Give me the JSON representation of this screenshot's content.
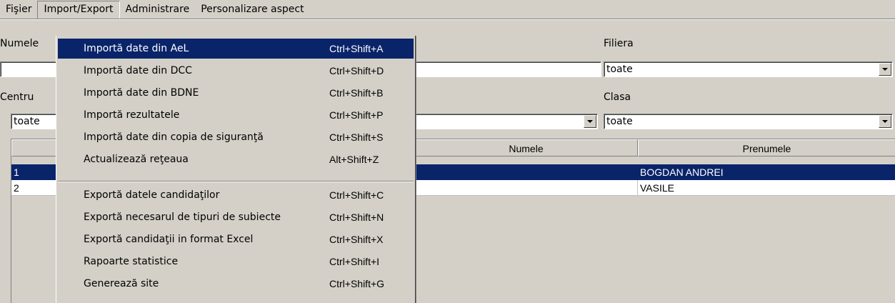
{
  "menubar": [
    "Fişier",
    "Import/Export",
    "Administrare",
    "Personalizare aspect"
  ],
  "filters": {
    "numele_label": "Numele",
    "filiera_label": "Filiera",
    "filiera_value": "toate",
    "centru_label": "Centru",
    "centru_value": "toate",
    "clasa_label": "Clasa",
    "clasa_value": "toate"
  },
  "grid": {
    "headers": {
      "numele": "Numele",
      "prenumele": "Prenumele"
    },
    "rows": [
      {
        "nr": "1",
        "prenumele": "BOGDAN ANDREI"
      },
      {
        "nr": "2",
        "prenumele": "VASILE"
      }
    ]
  },
  "menu": [
    {
      "label": "Importă date din AeL",
      "shortcut": "Ctrl+Shift+A"
    },
    {
      "label": "Importă date din DCC",
      "shortcut": "Ctrl+Shift+D"
    },
    {
      "label": "Importă date din BDNE",
      "shortcut": "Ctrl+Shift+B"
    },
    {
      "label": "Importă rezultatele",
      "shortcut": "Ctrl+Shift+P"
    },
    {
      "label": "Importă date din copia de siguranţă",
      "shortcut": "Ctrl+Shift+S"
    },
    {
      "label": "Actualizează reţeaua",
      "shortcut": "Alt+Shift+Z"
    },
    {
      "label": "Exportă datele candidaţilor",
      "shortcut": "Ctrl+Shift+C"
    },
    {
      "label": "Exportă necesarul de tipuri de subiecte",
      "shortcut": "Ctrl+Shift+N"
    },
    {
      "label": "Exportă candidaţii in format Excel",
      "shortcut": "Ctrl+Shift+X"
    },
    {
      "label": "Rapoarte statistice",
      "shortcut": "Ctrl+Shift+I"
    },
    {
      "label": "Generează site",
      "shortcut": "Ctrl+Shift+G"
    }
  ],
  "colors": {
    "selection": "#0a246a",
    "window": "#d4d0c8"
  }
}
